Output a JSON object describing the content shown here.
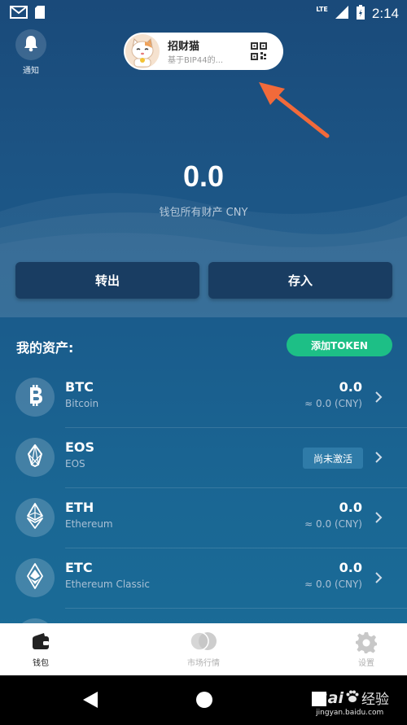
{
  "status_bar": {
    "time": "2:14",
    "network": "LTE"
  },
  "notifications": {
    "label": "通知"
  },
  "wallet": {
    "name": "招财猫",
    "subtitle": "基于BIP44的..."
  },
  "balance": {
    "amount": "0.0",
    "label": "钱包所有财产 CNY"
  },
  "actions": {
    "transfer_out": "转出",
    "deposit": "存入"
  },
  "assets": {
    "title": "我的资产:",
    "add_token_label": "添加TOKEN",
    "items": [
      {
        "symbol": "BTC",
        "name": "Bitcoin",
        "amount": "0.0",
        "fiat": "≈ 0.0 (CNY)",
        "icon": "bitcoin-icon"
      },
      {
        "symbol": "EOS",
        "name": "EOS",
        "status": "尚未激活",
        "icon": "eos-icon"
      },
      {
        "symbol": "ETH",
        "name": "Ethereum",
        "amount": "0.0",
        "fiat": "≈ 0.0 (CNY)",
        "icon": "ethereum-icon"
      },
      {
        "symbol": "ETC",
        "name": "Ethereum Classic",
        "amount": "0.0",
        "fiat": "≈ 0.0 (CNY)",
        "icon": "ethereum-classic-icon"
      }
    ]
  },
  "bottom_nav": {
    "items": [
      {
        "label": "钱包",
        "icon": "wallet-icon",
        "active": true
      },
      {
        "label": "市场行情",
        "icon": "market-icon",
        "active": false
      },
      {
        "label": "设置",
        "icon": "gear-icon",
        "active": false
      }
    ]
  },
  "watermark": {
    "brand": "Bai",
    "text": "经验",
    "url": "jingyan.baidu.com"
  },
  "colors": {
    "accent_green": "#1dbf86",
    "button_dark": "#193d62",
    "annotation_arrow": "#f26a3a"
  }
}
